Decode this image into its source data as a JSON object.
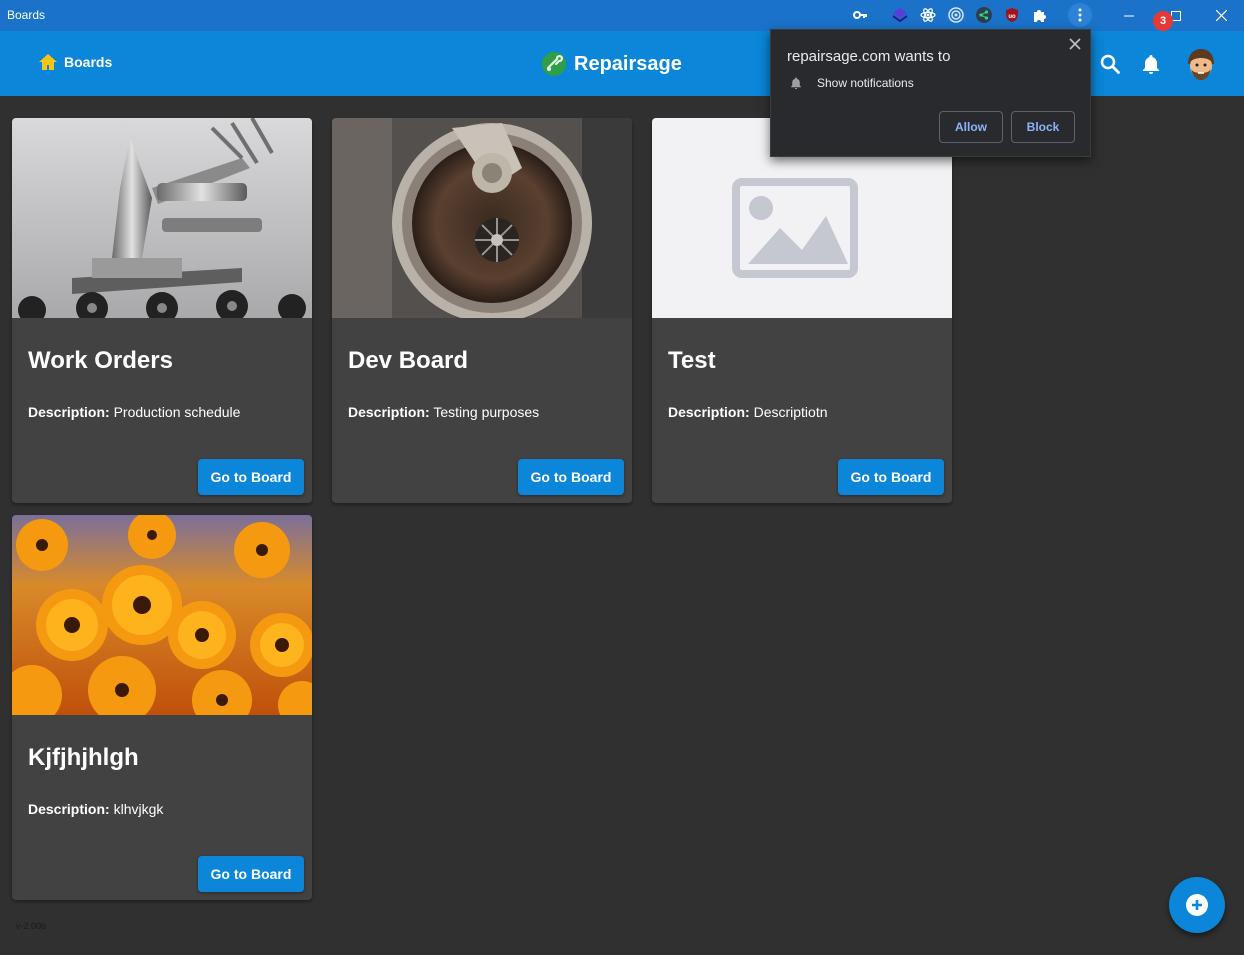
{
  "window": {
    "title": "Boards"
  },
  "browser_extensions": [
    "key-icon",
    "layers-icon",
    "react-icon",
    "target-icon",
    "share-icon",
    "ublock-icon",
    "puzzle-icon"
  ],
  "header": {
    "boards_label": "Boards",
    "brand_name": "Repairsage",
    "notification_count": "3"
  },
  "boards": [
    {
      "title": "Work Orders",
      "description_label": "Description:",
      "description": " Production schedule",
      "button": "Go to Board",
      "image": "machine-photo"
    },
    {
      "title": "Dev Board",
      "description_label": "Description:",
      "description": " Testing purposes",
      "button": "Go to Board",
      "image": "turbo-photo"
    },
    {
      "title": "Test",
      "description_label": "Description:",
      "description": " Descriptiotn",
      "button": "Go to Board",
      "image": "placeholder-image"
    },
    {
      "title": "Kjfjhjhlgh",
      "description_label": "Description:",
      "description": " klhvjkgk",
      "button": "Go to Board",
      "image": "flowers-photo"
    }
  ],
  "version": "v-2.00b",
  "permission_prompt": {
    "title": "repairsage.com wants to",
    "item": "Show notifications",
    "allow": "Allow",
    "block": "Block"
  },
  "colors": {
    "titlebar": "#1a73c9",
    "appbar": "#0b86d8",
    "background": "#303030",
    "card": "#424242",
    "badge": "#e53935"
  }
}
